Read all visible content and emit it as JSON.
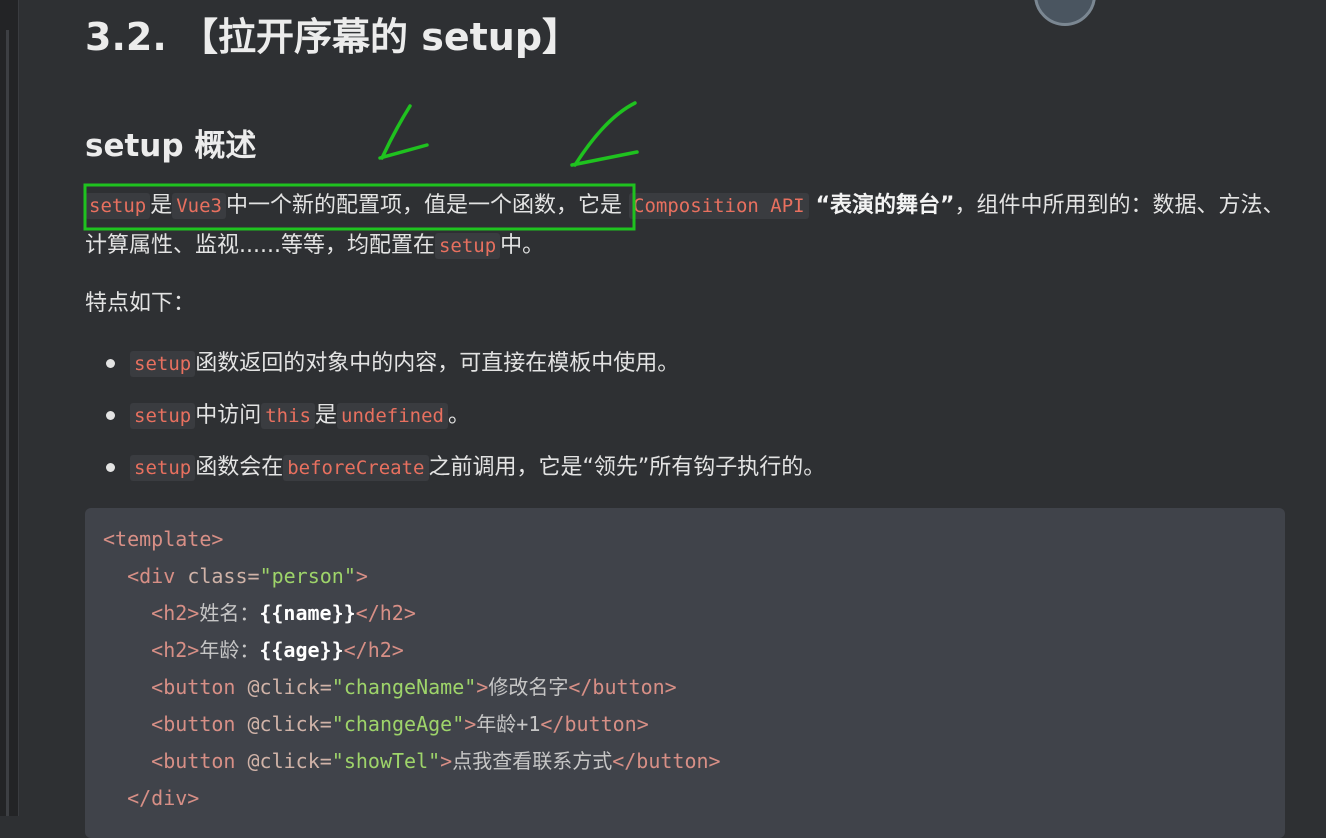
{
  "heading": "3.2. 【拉开序幕的 setup】",
  "subheading": "setup 概述",
  "intro": {
    "code_setup": "setup",
    "t_is": "是",
    "code_vue3": "Vue3",
    "t_mid": "中一个新的配置项，值是一个函数，它是",
    "code_api": "Composition API",
    "bold_stage": "“表演的舞台”",
    "t_tail": "，组件中所用到的：数据、方法、计算属性、监视......等等，均配置在",
    "code_setup2": "setup",
    "t_end": "中。"
  },
  "features_label": "特点如下：",
  "features": [
    {
      "c1": "setup",
      "t1": "函数返回的对象中的内容，可直接在模板中使用。"
    },
    {
      "c1": "setup",
      "t1": "中访问",
      "c2": "this",
      "t2": "是",
      "c3": "undefined",
      "t3": "。"
    },
    {
      "c1": "setup",
      "t1": "函数会在",
      "c2": "beforeCreate",
      "t2": "之前调用，它是“领先”所有钩子执行的。"
    }
  ],
  "code": {
    "l1_tag": "<template>",
    "l2_open": "<div ",
    "l2_attr": "class=",
    "l2_str": "\"person\"",
    "l2_close": ">",
    "l3_open": "<h2>",
    "l3_text": "姓名：",
    "l3_mus": "{{name}}",
    "l3_close": "</h2>",
    "l4_open": "<h2>",
    "l4_text": "年龄：",
    "l4_mus": "{{age}}",
    "l4_close": "</h2>",
    "l5_open": "<button ",
    "l5_attr": "@click=",
    "l5_str": "\"changeName\"",
    "l5_gt": ">",
    "l5_text": "修改名字",
    "l5_close": "</button>",
    "l6_open": "<button ",
    "l6_attr": "@click=",
    "l6_str": "\"changeAge\"",
    "l6_gt": ">",
    "l6_text": "年龄+1",
    "l6_close": "</button>",
    "l7_open": "<button ",
    "l7_attr": "@click=",
    "l7_str": "\"showTel\"",
    "l7_gt": ">",
    "l7_text": "点我查看联系方式",
    "l7_close": "</button>",
    "l8_tag": "</div>"
  },
  "colors": {
    "background": "#2e3033",
    "inline_code": "#e8705f",
    "annotation": "#1fc21f",
    "code_block_bg": "#40434a"
  }
}
